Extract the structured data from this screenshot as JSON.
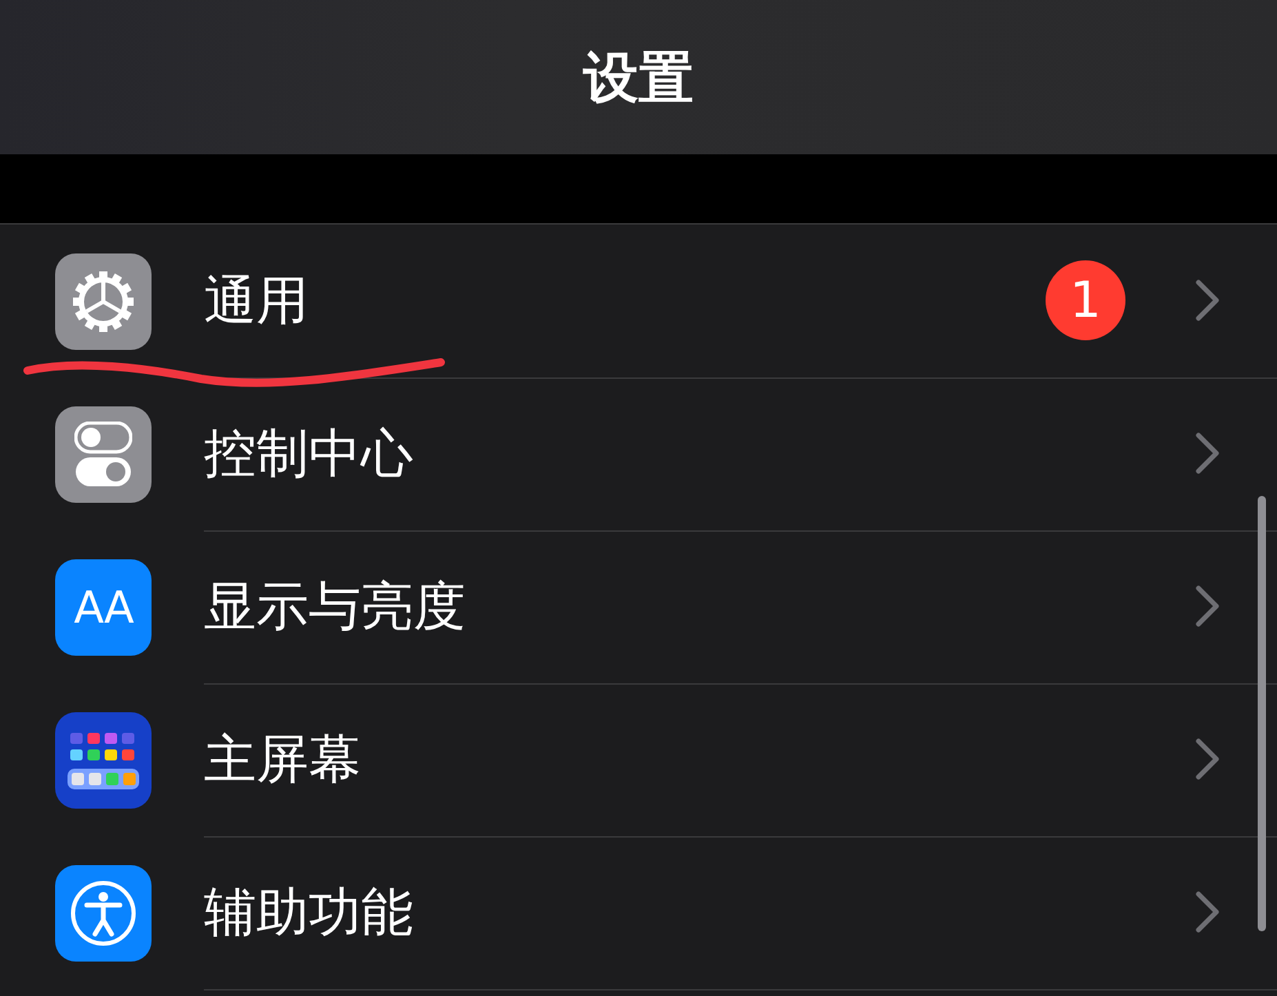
{
  "title": "设置",
  "rows": [
    {
      "label": "通用",
      "kind": "gear",
      "badge": "1",
      "underlined": true
    },
    {
      "label": "控制中心",
      "kind": "toggles",
      "underlined": false
    },
    {
      "label": "显示与亮度",
      "kind": "text",
      "icon_text": "AA",
      "underlined": false
    },
    {
      "label": "主屏幕",
      "kind": "grid",
      "underlined": false
    },
    {
      "label": "辅助功能",
      "kind": "accessibility",
      "underlined": false
    }
  ]
}
